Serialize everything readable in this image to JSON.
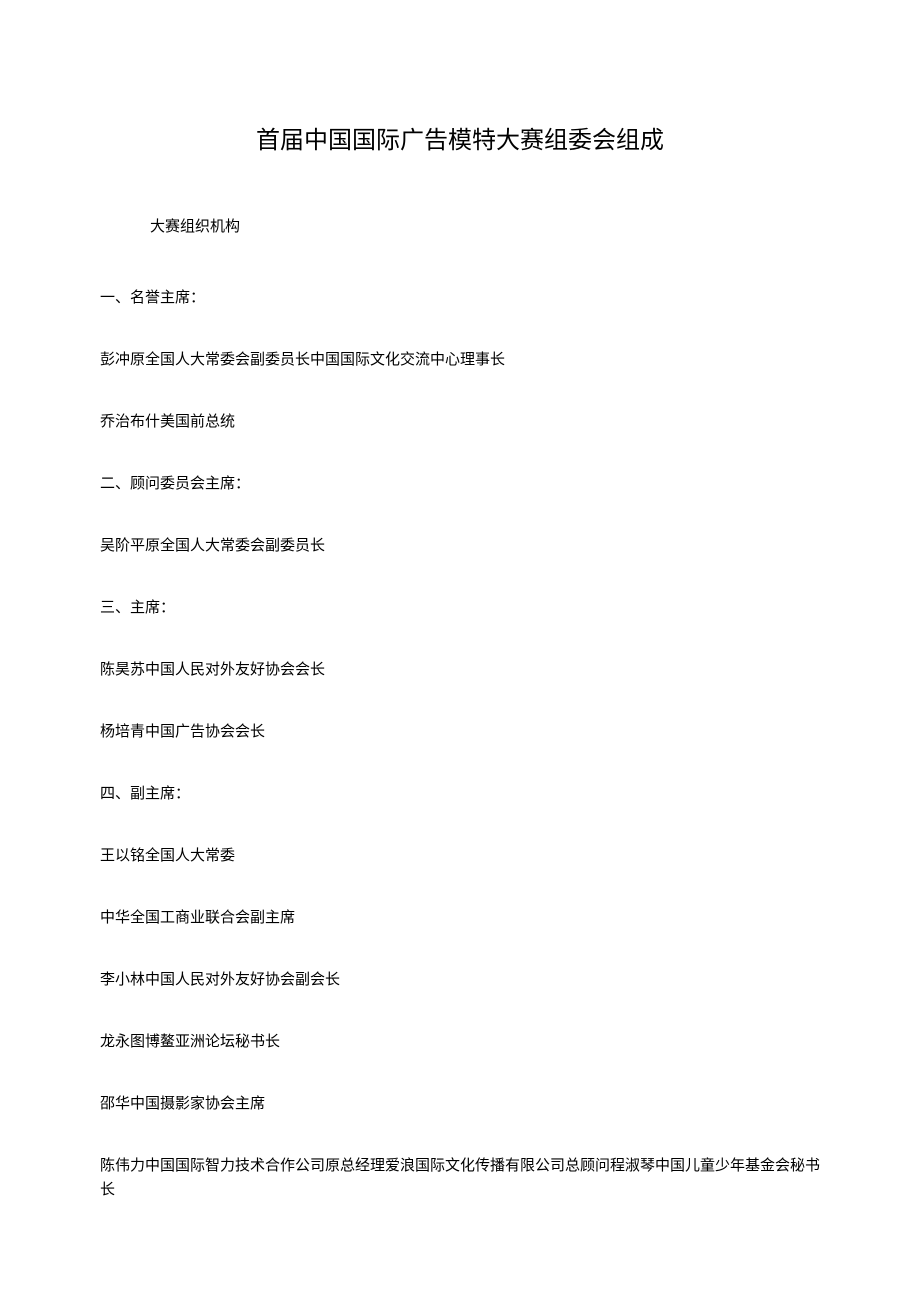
{
  "title": "首届中国国际广告模特大赛组委会组成",
  "subtitle": "大赛组织机构",
  "paragraphs": [
    "一、名誉主席：",
    "彭冲原全国人大常委会副委员长中国国际文化交流中心理事长",
    "乔治布什美国前总统",
    "二、顾问委员会主席：",
    "吴阶平原全国人大常委会副委员长",
    "三、主席：",
    "陈昊苏中国人民对外友好协会会长",
    "杨培青中国广告协会会长",
    "四、副主席：",
    "王以铭全国人大常委",
    "中华全国工商业联合会副主席",
    "李小林中国人民对外友好协会副会长",
    "龙永图博鳌亚洲论坛秘书长",
    "邵华中国摄影家协会主席",
    "陈伟力中国国际智力技术合作公司原总经理爱浪国际文化传播有限公司总顾问程淑琴中国儿童少年基金会秘书长"
  ]
}
